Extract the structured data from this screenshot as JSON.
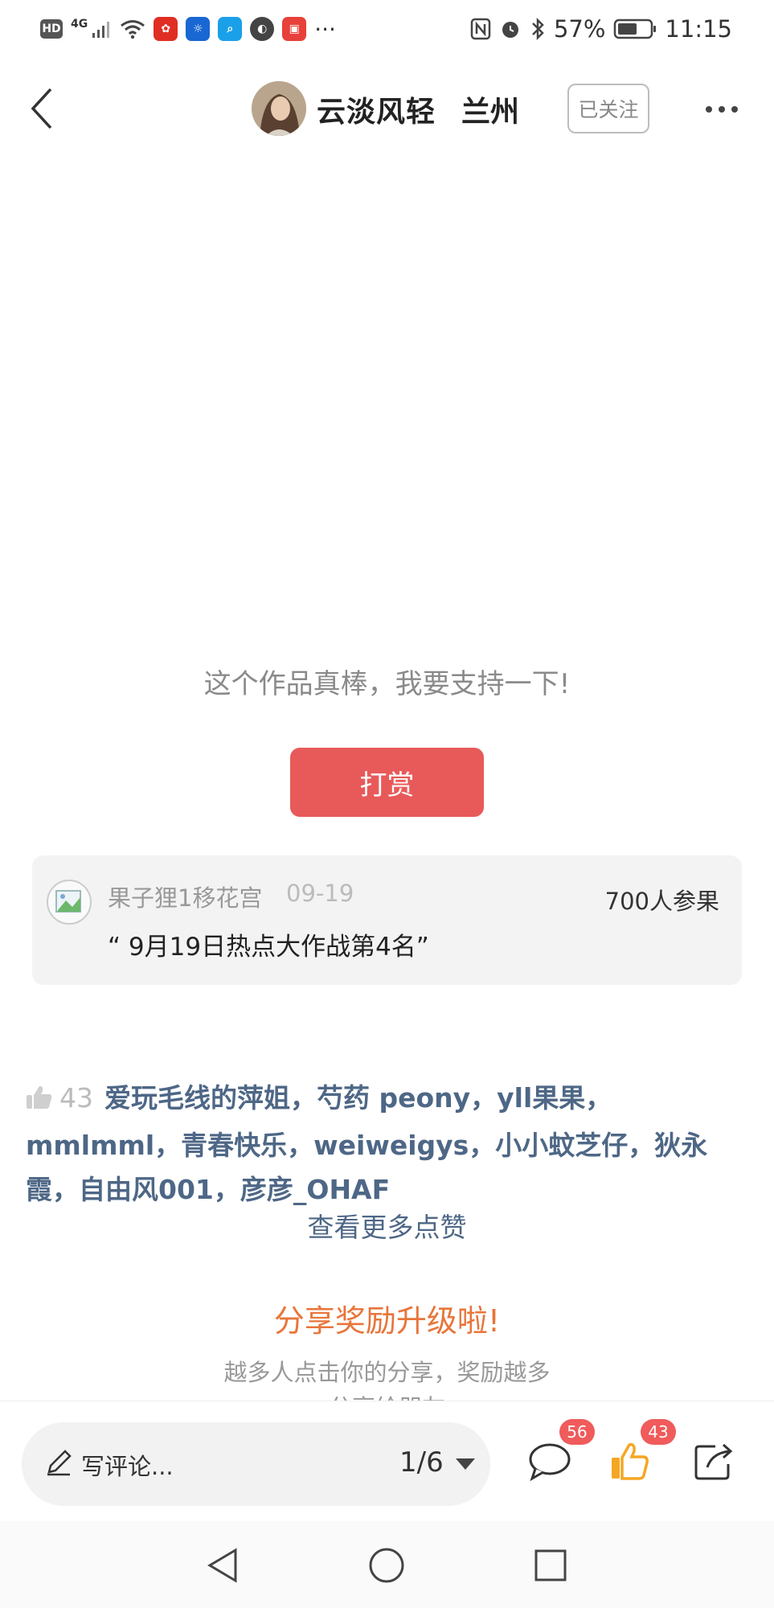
{
  "status_bar": {
    "hd": "HD",
    "net": "4G",
    "more": "···",
    "battery": "57%",
    "time": "11:15",
    "apps": [
      {
        "icon": "pinduoduo-icon",
        "color": "#e02e24"
      },
      {
        "icon": "bulb-app-icon",
        "color": "#1967d2"
      },
      {
        "icon": "search-app-icon",
        "color": "#1aa0e8"
      },
      {
        "icon": "globe-app-icon",
        "color": "#444444"
      },
      {
        "icon": "meipai-app-icon",
        "color": "#e8403a"
      }
    ]
  },
  "header": {
    "author_name": "云淡风轻",
    "author_location": "兰州",
    "follow_label": "已关注"
  },
  "reward": {
    "support_text": "这个作品真棒，我要支持一下!",
    "button_label": "打赏"
  },
  "award": {
    "user": "果子狸1移花宫",
    "date": "09-19",
    "participants": "700人参果",
    "title": "“ 9月19日热点大作战第4名”"
  },
  "likes": {
    "count": "43",
    "names": "爱玩毛线的萍姐，芍药 peony，yll果果，mmlmml，青春快乐，weiweigys，小小蚊芝仔，狄永霞，自由风001，彦彦_OHAF",
    "more_label": "查看更多点赞"
  },
  "share_promo": {
    "title": "分享奖励升级啦!",
    "desc": "越多人点击你的分享，奖励越多",
    "desc_cut": "分享给朋友"
  },
  "toolbar": {
    "comment_placeholder": "写评论...",
    "page_indicator": "1/6",
    "comment_count": "56",
    "like_count": "43"
  },
  "colors": {
    "reward": "#e85a5a",
    "link": "#4e6786",
    "promo": "#e8753a",
    "badge": "#f05b5b",
    "like_icon": "#f5a623"
  }
}
